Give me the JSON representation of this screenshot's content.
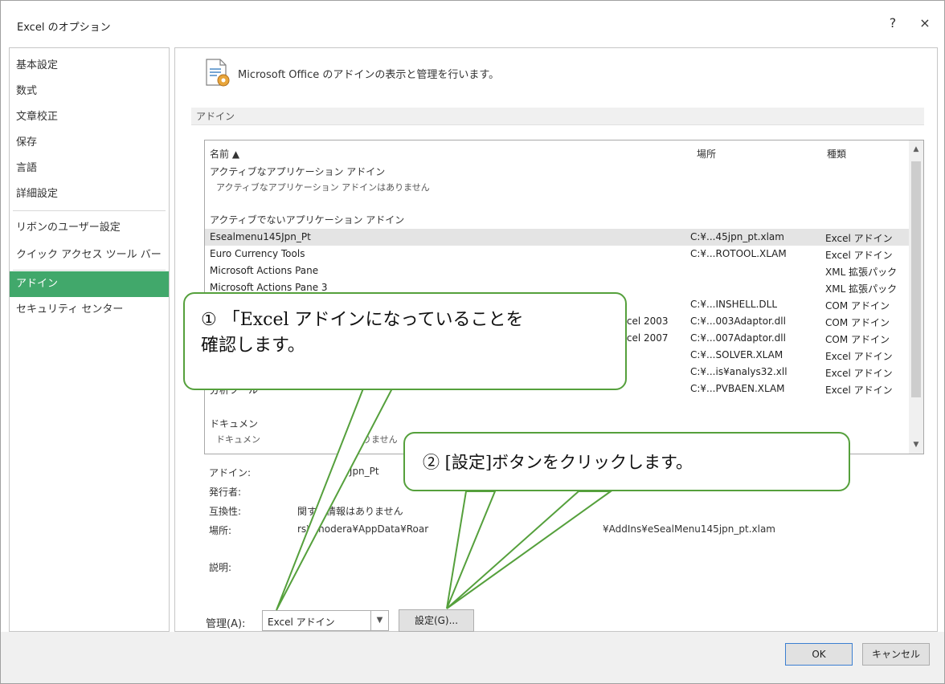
{
  "window": {
    "title": "Excel のオプション",
    "help_glyph": "?",
    "close_glyph": "×"
  },
  "nav": {
    "items": [
      {
        "label": "基本設定"
      },
      {
        "label": "数式"
      },
      {
        "label": "文章校正"
      },
      {
        "label": "保存"
      },
      {
        "label": "言語"
      },
      {
        "label": "詳細設定"
      },
      {
        "label": "リボンのユーザー設定"
      },
      {
        "label": "クイック アクセス ツール バー"
      },
      {
        "label": "アドイン",
        "active": true
      },
      {
        "label": "セキュリティ センター"
      }
    ]
  },
  "header": {
    "text": "Microsoft Office のアドインの表示と管理を行います。"
  },
  "section": {
    "title": "アドイン"
  },
  "list": {
    "columns": {
      "name": "名前 ▲",
      "location": "場所",
      "type": "種類"
    },
    "active_group": {
      "title": "アクティブなアプリケーション アドイン",
      "empty": "アクティブなアプリケーション アドインはありません"
    },
    "inactive_group": {
      "title": "アクティブでないアプリケーション アドイン"
    },
    "rows": [
      {
        "name": "Esealmenu145Jpn_Pt",
        "location": "C:¥...45jpn_pt.xlam",
        "type": "Excel アドイン",
        "selected": true
      },
      {
        "name": "Euro Currency Tools",
        "location": "C:¥...ROTOOL.XLAM",
        "type": "Excel アドイン"
      },
      {
        "name": "Microsoft Actions Pane",
        "location": "",
        "type": "XML 拡張パック"
      },
      {
        "name": "Microsoft Actions Pane 3",
        "location": "",
        "type": "XML 拡張パック"
      },
      {
        "name": "",
        "location": "C:¥...INSHELL.DLL",
        "type": "COM アドイン"
      },
      {
        "name": "xcel 2003",
        "location": "C:¥...003Adaptor.dll",
        "type": "COM アドイン"
      },
      {
        "name": "xcel 2007",
        "location": "C:¥...007Adaptor.dll",
        "type": "COM アドイン"
      },
      {
        "name": "",
        "location": "C:¥...SOLVER.XLAM",
        "type": "Excel アドイン"
      },
      {
        "name": "",
        "location": "C:¥...is¥analys32.xll",
        "type": "Excel アドイン"
      },
      {
        "name": "分析ツール",
        "location": "C:¥...PVBAEN.XLAM",
        "type": "Excel アドイン"
      }
    ],
    "doc_group": {
      "title": "ドキュメン",
      "empty": "ドキュメン"
    },
    "doc_empty_tail": "りません"
  },
  "details": {
    "addin_label": "アドイン:",
    "addin_value": "145Jpn_Pt",
    "publisher_label": "発行者:",
    "publisher_value": "",
    "compat_label": "互換性:",
    "compat_value": "関する情報はありません",
    "location_label": "場所:",
    "location_value": "rs¥onodera¥AppData¥Roar",
    "location_tail": "¥AddIns¥eSealMenu145jpn_pt.xlam",
    "desc_label": "説明:",
    "desc_value": ""
  },
  "manage": {
    "label": "管理(A):",
    "selected": "Excel アドイン",
    "go_label": "設定(G)..."
  },
  "footer": {
    "ok_label": "OK",
    "cancel_label": "キャンセル"
  },
  "callouts": {
    "first_line1": "① 「Excel アドインになっていることを",
    "first_line2": "確認します。",
    "second": "② [設定]ボタンをクリックします。"
  },
  "colors": {
    "accent": "#41a86b",
    "callout_border": "#55a03c"
  }
}
